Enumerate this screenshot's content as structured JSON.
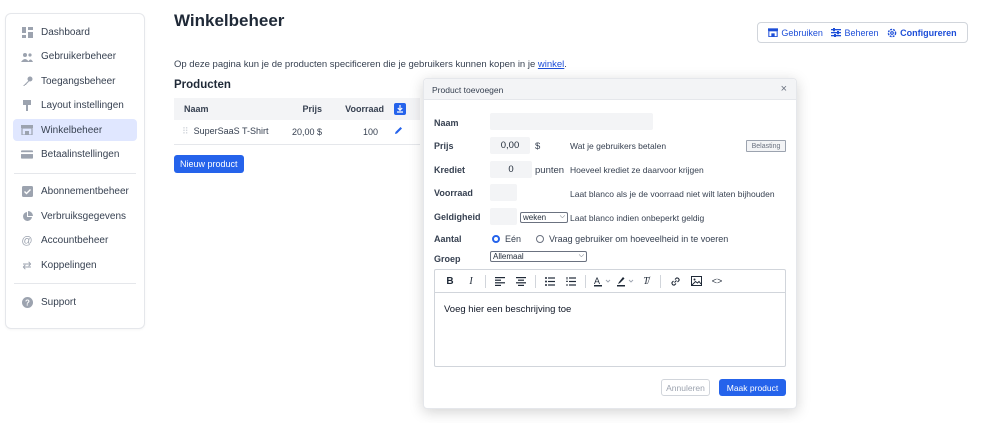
{
  "sidebar": {
    "items": [
      {
        "label": "Dashboard",
        "icon": "dashboard-icon",
        "active": false
      },
      {
        "label": "Gebruikerbeheer",
        "icon": "users-icon",
        "active": false
      },
      {
        "label": "Toegangsbeheer",
        "icon": "key-icon",
        "active": false
      },
      {
        "label": "Layout instellingen",
        "icon": "brush-icon",
        "active": false
      },
      {
        "label": "Winkelbeheer",
        "icon": "store-icon",
        "active": true
      },
      {
        "label": "Betaalinstellingen",
        "icon": "credit-card-icon",
        "active": false
      },
      {
        "label": "Abonnementbeheer",
        "icon": "subscription-icon",
        "active": false
      },
      {
        "label": "Verbruiksgegevens",
        "icon": "pie-chart-icon",
        "active": false
      },
      {
        "label": "Accountbeheer",
        "icon": "at-icon",
        "active": false
      },
      {
        "label": "Koppelingen",
        "icon": "arrows-icon",
        "active": false
      },
      {
        "label": "Support",
        "icon": "help-icon",
        "active": false
      }
    ]
  },
  "page": {
    "title": "Winkelbeheer",
    "intro": "Op deze pagina kun je de producten specificeren die je gebruikers kunnen kopen in je ",
    "intro_link": "winkel",
    "intro_end": ".",
    "section_title": "Producten"
  },
  "top_tabs": [
    {
      "label": "Gebruiken",
      "icon": "store-icon"
    },
    {
      "label": "Beheren",
      "icon": "sliders-icon"
    },
    {
      "label": "Configureren",
      "icon": "gear-icon"
    }
  ],
  "products_table": {
    "headers": [
      "Naam",
      "Prijs",
      "Voorraad"
    ],
    "rows": [
      {
        "name": "SuperSaaS T-Shirt",
        "price": "20,00 $",
        "stock": "100"
      }
    ]
  },
  "new_product_label": "Nieuw product",
  "modal": {
    "title": "Product toevoegen",
    "close": "×",
    "name_label": "Naam",
    "name_value": "",
    "price_label": "Prijs",
    "price_value": "0,00",
    "price_unit": "$",
    "price_help": "Wat je gebruikers betalen",
    "tax_label": "Belasting",
    "credit_label": "Krediet",
    "credit_value": "0",
    "credit_unit": "punten",
    "credit_help": "Hoeveel krediet ze daarvoor krijgen",
    "stock_label": "Voorraad",
    "stock_value": "",
    "stock_help": "Laat blanco als je de voorraad niet wilt laten bijhouden",
    "validity_label": "Geldigheid",
    "validity_value": "",
    "validity_unit": "weken",
    "validity_help": "Laat blanco indien onbeperkt geldig",
    "quantity_label": "Aantal",
    "quantity_opt1": "Eén",
    "quantity_opt2": "Vraag gebruiker om hoeveelheid in te voeren",
    "group_label": "Groep",
    "group_value": "Allemaal",
    "editor_text": "Voeg hier een beschrijving toe",
    "cancel_label": "Annuleren",
    "create_label": "Maak product"
  },
  "colors": {
    "accent": "#2563eb",
    "active_bg": "#e0e7ff"
  }
}
